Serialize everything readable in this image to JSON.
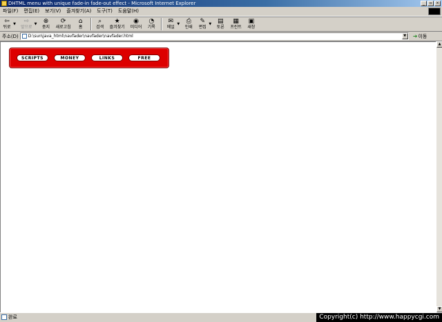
{
  "window": {
    "title": "DHTML menu with unique fade-in fade-out effect - Microsoft Internet Explorer",
    "controls": [
      "_",
      "▫",
      "×"
    ]
  },
  "menubar": {
    "items": [
      "파일(F)",
      "편집(E)",
      "보기(V)",
      "즐겨찾기(A)",
      "도구(T)",
      "도움말(H)"
    ]
  },
  "toolbar": {
    "back": "뒤로",
    "forward": "앞으로",
    "stop": "중지",
    "refresh": "새로고침",
    "home": "홈",
    "search": "검색",
    "favorites": "즐겨찾기",
    "media": "미디어",
    "history": "기록",
    "mail": "메일",
    "print": "인쇄",
    "edit": "편집",
    "discuss": "토론",
    "printer": "프린트",
    "messenger": "새창"
  },
  "address": {
    "label": "주소(D)",
    "value": "D:\\sun\\java_html\\navfader\\navfader\\navfader.html",
    "go_label": "이동"
  },
  "navmenu": {
    "buttons": [
      "SCRIPTS",
      "MONEY",
      "LINKS",
      "FREE"
    ]
  },
  "status": {
    "text": "완료",
    "copyright": "Copyright(c) http://www.happycgi.com"
  },
  "colors": {
    "titlebar_start": "#0a246a",
    "nav_red": "#dd0000",
    "chrome": "#d4d0c8"
  }
}
